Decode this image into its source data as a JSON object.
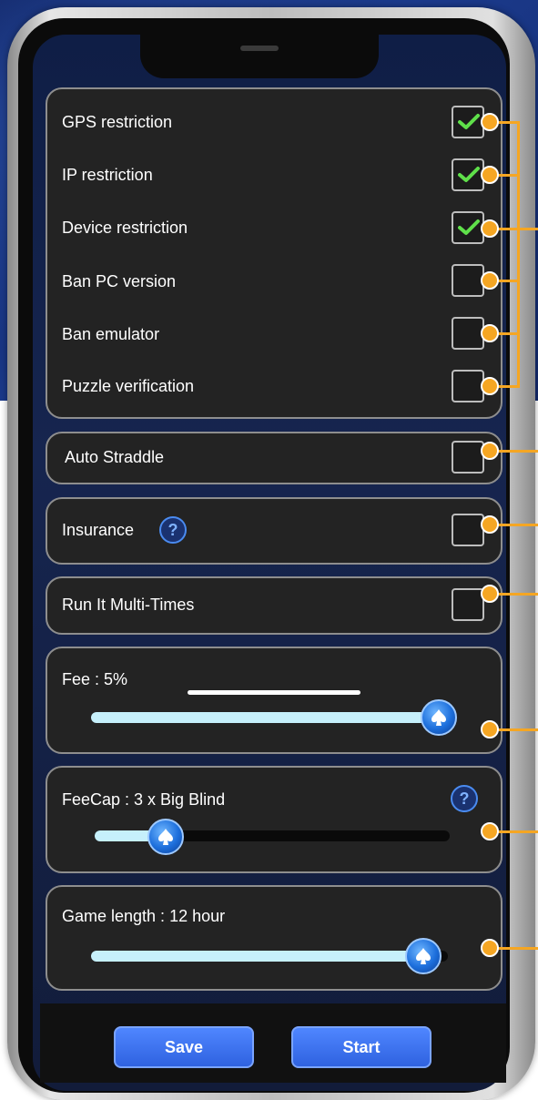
{
  "settings": {
    "gps_restriction": {
      "label": "GPS restriction",
      "checked": true
    },
    "ip_restriction": {
      "label": "IP restriction",
      "checked": true
    },
    "device_restriction": {
      "label": "Device restriction",
      "checked": true
    },
    "ban_pc_version": {
      "label": "Ban PC version",
      "checked": false
    },
    "ban_emulator": {
      "label": "Ban emulator",
      "checked": false
    },
    "puzzle_verification": {
      "label": "Puzzle verification",
      "checked": false
    }
  },
  "auto_straddle": {
    "label": "Auto Straddle",
    "checked": false
  },
  "insurance": {
    "label": "Insurance",
    "help": "?",
    "checked": false
  },
  "run_it_multi_times": {
    "label": "Run It Multi-Times",
    "checked": false
  },
  "fee": {
    "label": "Fee : 5%",
    "level_fraction": 0.97
  },
  "fee_cap": {
    "label": "FeeCap : 3 x Big Blind",
    "help": "?",
    "level_fraction": 0.2
  },
  "game_length": {
    "label": "Game length : 12 hour",
    "level_fraction": 0.93
  },
  "actions": {
    "save_label": "Save",
    "start_label": "Start"
  },
  "colors": {
    "accent": "#f5a623",
    "button": "#3b6ff0",
    "check": "#5fe04a",
    "slider_fill": "#c6f0fb"
  },
  "icons": {
    "check": "check-icon",
    "slider_thumb": "spade-icon",
    "help": "question-icon"
  }
}
